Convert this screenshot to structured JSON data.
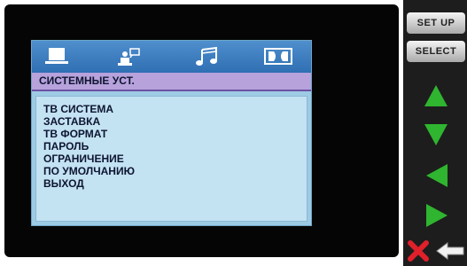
{
  "colors": {
    "accent_green": "#2fb52f",
    "close_red": "#e0202a",
    "title_bar": "#b7a2dc",
    "menu_background": "#c3e2f2",
    "tab_bar": "#3d7ec2"
  },
  "tabs": [
    {
      "icon": "monitor-icon"
    },
    {
      "icon": "user-speech-icon"
    },
    {
      "icon": "music-note-icon"
    },
    {
      "icon": "dolby-icon"
    }
  ],
  "osd": {
    "title": "СИСТЕМНЫЕ УСТ.",
    "items": [
      "ТВ СИСТЕМА",
      "ЗАСТАВКА",
      "ТВ ФОРМАТ",
      "ПАРОЛЬ",
      "ОГРАНИЧЕНИЕ",
      "ПО УМОЛЧАНИЮ",
      "ВЫХОД"
    ]
  },
  "sidebar": {
    "setup_label": "SET UP",
    "select_label": "SELECT",
    "icons": [
      "up-arrow-icon",
      "down-arrow-icon",
      "left-arrow-icon",
      "right-arrow-icon",
      "close-icon",
      "back-icon"
    ]
  }
}
